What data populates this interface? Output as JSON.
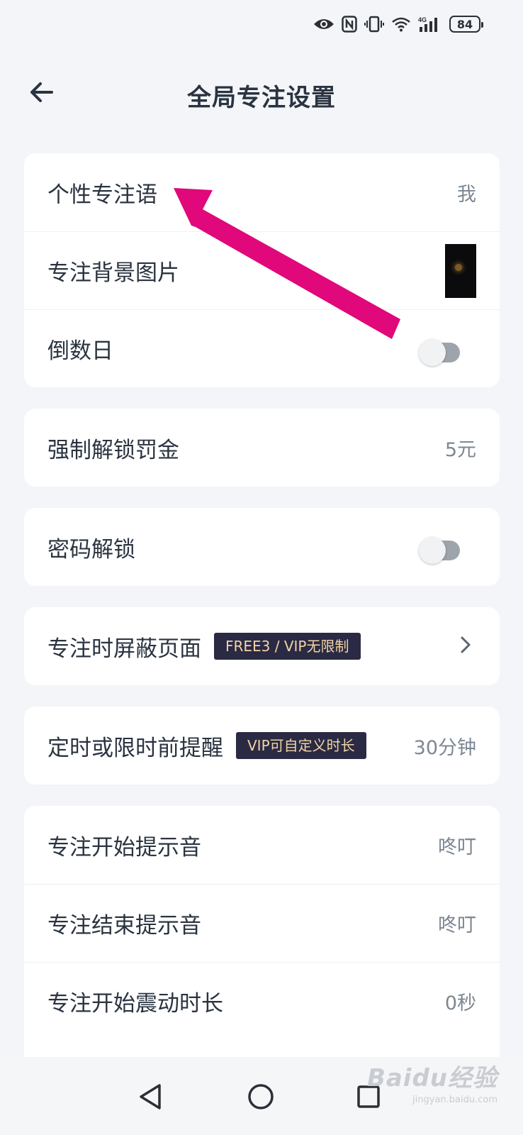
{
  "status_bar": {
    "icons": [
      "eye-icon",
      "nfc-icon",
      "vibrate-icon",
      "wifi-icon",
      "signal-4g-icon",
      "battery-icon"
    ],
    "network_label": "4G",
    "battery_level": "84"
  },
  "header": {
    "title": "全局专注设置",
    "back_icon": "back-arrow-icon"
  },
  "groups": {
    "basic": {
      "motto_label": "个性专注语",
      "motto_value": "我",
      "background_label": "专注背景图片",
      "countdown_label": "倒数日",
      "countdown_enabled": false
    },
    "penalty": {
      "label": "强制解锁罚金",
      "value": "5元"
    },
    "password": {
      "label": "密码解锁",
      "enabled": false
    },
    "block_pages": {
      "label": "专注时屏蔽页面",
      "badge": "FREE3 / VIP无限制",
      "chevron_icon": "chevron-right-icon"
    },
    "reminder": {
      "label": "定时或限时前提醒",
      "badge": "VIP可自定义时长",
      "value": "30分钟"
    },
    "sounds": {
      "start_sound_label": "专注开始提示音",
      "start_sound_value": "咚叮",
      "end_sound_label": "专注结束提示音",
      "end_sound_value": "咚叮",
      "vibrate_label": "专注开始震动时长",
      "vibrate_value": "0秒"
    }
  },
  "annotation": {
    "arrow_color": "#e0087a",
    "points_to": "个性专注语"
  },
  "nav_bar": {
    "back_icon": "nav-back-triangle-icon",
    "home_icon": "nav-home-circle-icon",
    "recents_icon": "nav-recents-square-icon"
  },
  "watermark": {
    "main": "Baidu经验",
    "sub": "jingyan.baidu.com"
  },
  "colors": {
    "background": "#f3f5f8",
    "card": "#ffffff",
    "badge_bg": "#2b2a44",
    "badge_text": "#f0d4a4",
    "text_primary": "#2a3340",
    "text_secondary": "#7d8793"
  }
}
